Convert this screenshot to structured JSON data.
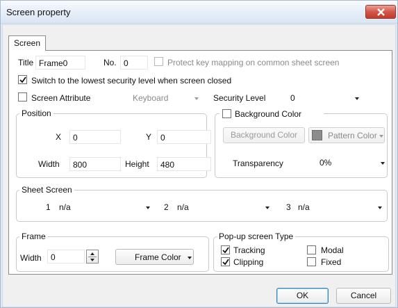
{
  "window": {
    "title": "Screen property"
  },
  "tabs": [
    "Screen"
  ],
  "screen": {
    "title_label": "Title",
    "title_value": "Frame0",
    "no_label": "No.",
    "no_value": "0",
    "protect_label": "Protect key mapping on common sheet screen",
    "protect_checked": false,
    "switch_label": "Switch to the lowest security level when screen closed",
    "switch_checked": true,
    "attr_label": "Screen Attribute",
    "attr_checked": false,
    "attr_value": "Keyboard",
    "security_label": "Security Level",
    "security_value": "0"
  },
  "position": {
    "label": "Position",
    "x_label": "X",
    "x_value": "0",
    "y_label": "Y",
    "y_value": "0",
    "width_label": "Width",
    "width_value": "800",
    "height_label": "Height",
    "height_value": "480"
  },
  "background": {
    "label": "Background Color",
    "checked": false,
    "bg_button": "Background Color",
    "pattern_button": "Pattern Color",
    "transparency_label": "Transparency",
    "transparency_value": "0%"
  },
  "sheet": {
    "label": "Sheet Screen",
    "items": [
      {
        "num": "1",
        "value": "n/a"
      },
      {
        "num": "2",
        "value": "n/a"
      },
      {
        "num": "3",
        "value": "n/a"
      }
    ]
  },
  "frame": {
    "label": "Frame",
    "width_label": "Width",
    "width_value": "0",
    "color_button": "Frame Color"
  },
  "popup": {
    "label": "Pop-up screen Type",
    "tracking": "Tracking",
    "tracking_checked": true,
    "clipping": "Clipping",
    "clipping_checked": true,
    "modal": "Modal",
    "modal_checked": false,
    "fixed": "Fixed",
    "fixed_checked": false
  },
  "footer": {
    "ok": "OK",
    "cancel": "Cancel"
  },
  "colors": {
    "close_button": "#c8473a",
    "swatch": "#8c8c8c",
    "ok_border": "#3c7fb1"
  }
}
